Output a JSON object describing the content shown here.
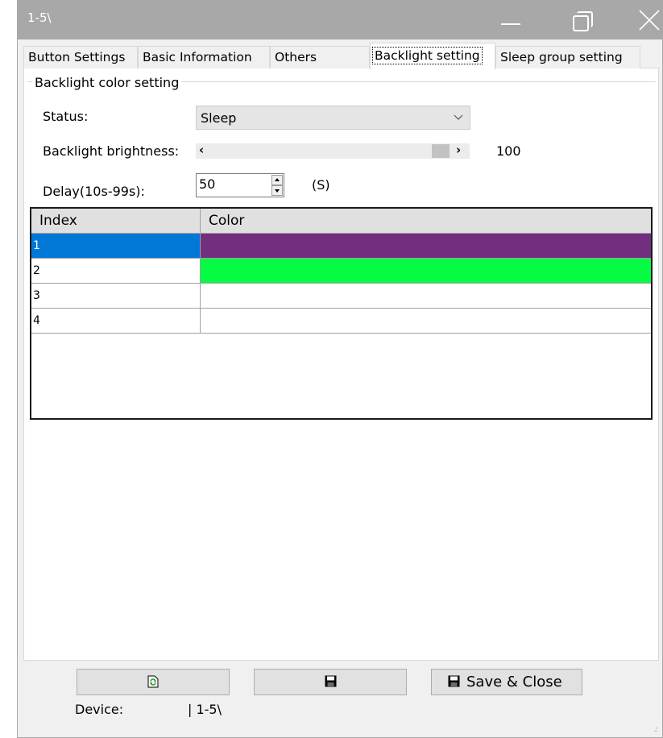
{
  "window": {
    "title": "1-5\\"
  },
  "tabs": [
    {
      "label": "Button Settings",
      "active": false
    },
    {
      "label": "Basic Information",
      "active": false
    },
    {
      "label": "Others",
      "active": false
    },
    {
      "label": "Backlight setting",
      "active": true
    },
    {
      "label": "Sleep group setting",
      "active": false
    }
  ],
  "backlight": {
    "group_title": "Backlight color setting",
    "status_label": "Status:",
    "status_value": "Sleep",
    "brightness_label": "Backlight brightness:",
    "brightness_value": "100",
    "brightness_max": 100,
    "delay_label": "Delay(10s-99s):",
    "delay_value": "50",
    "delay_unit": "(S)"
  },
  "grid": {
    "columns": [
      "Index",
      "Color"
    ],
    "rows": [
      {
        "index": "1",
        "color": "#722f80",
        "selected": true
      },
      {
        "index": "2",
        "color": "#05fc43",
        "selected": false
      },
      {
        "index": "3",
        "color": "",
        "selected": false
      },
      {
        "index": "4",
        "color": "",
        "selected": false
      }
    ]
  },
  "buttons": {
    "save_close_label": "Save & Close"
  },
  "status_bar": {
    "device_label": "Device:",
    "device_value": "| 1-5\\"
  },
  "icons": {
    "refresh": "refresh-icon",
    "save": "floppy-disk-icon",
    "save_close": "floppy-disk-icon"
  }
}
